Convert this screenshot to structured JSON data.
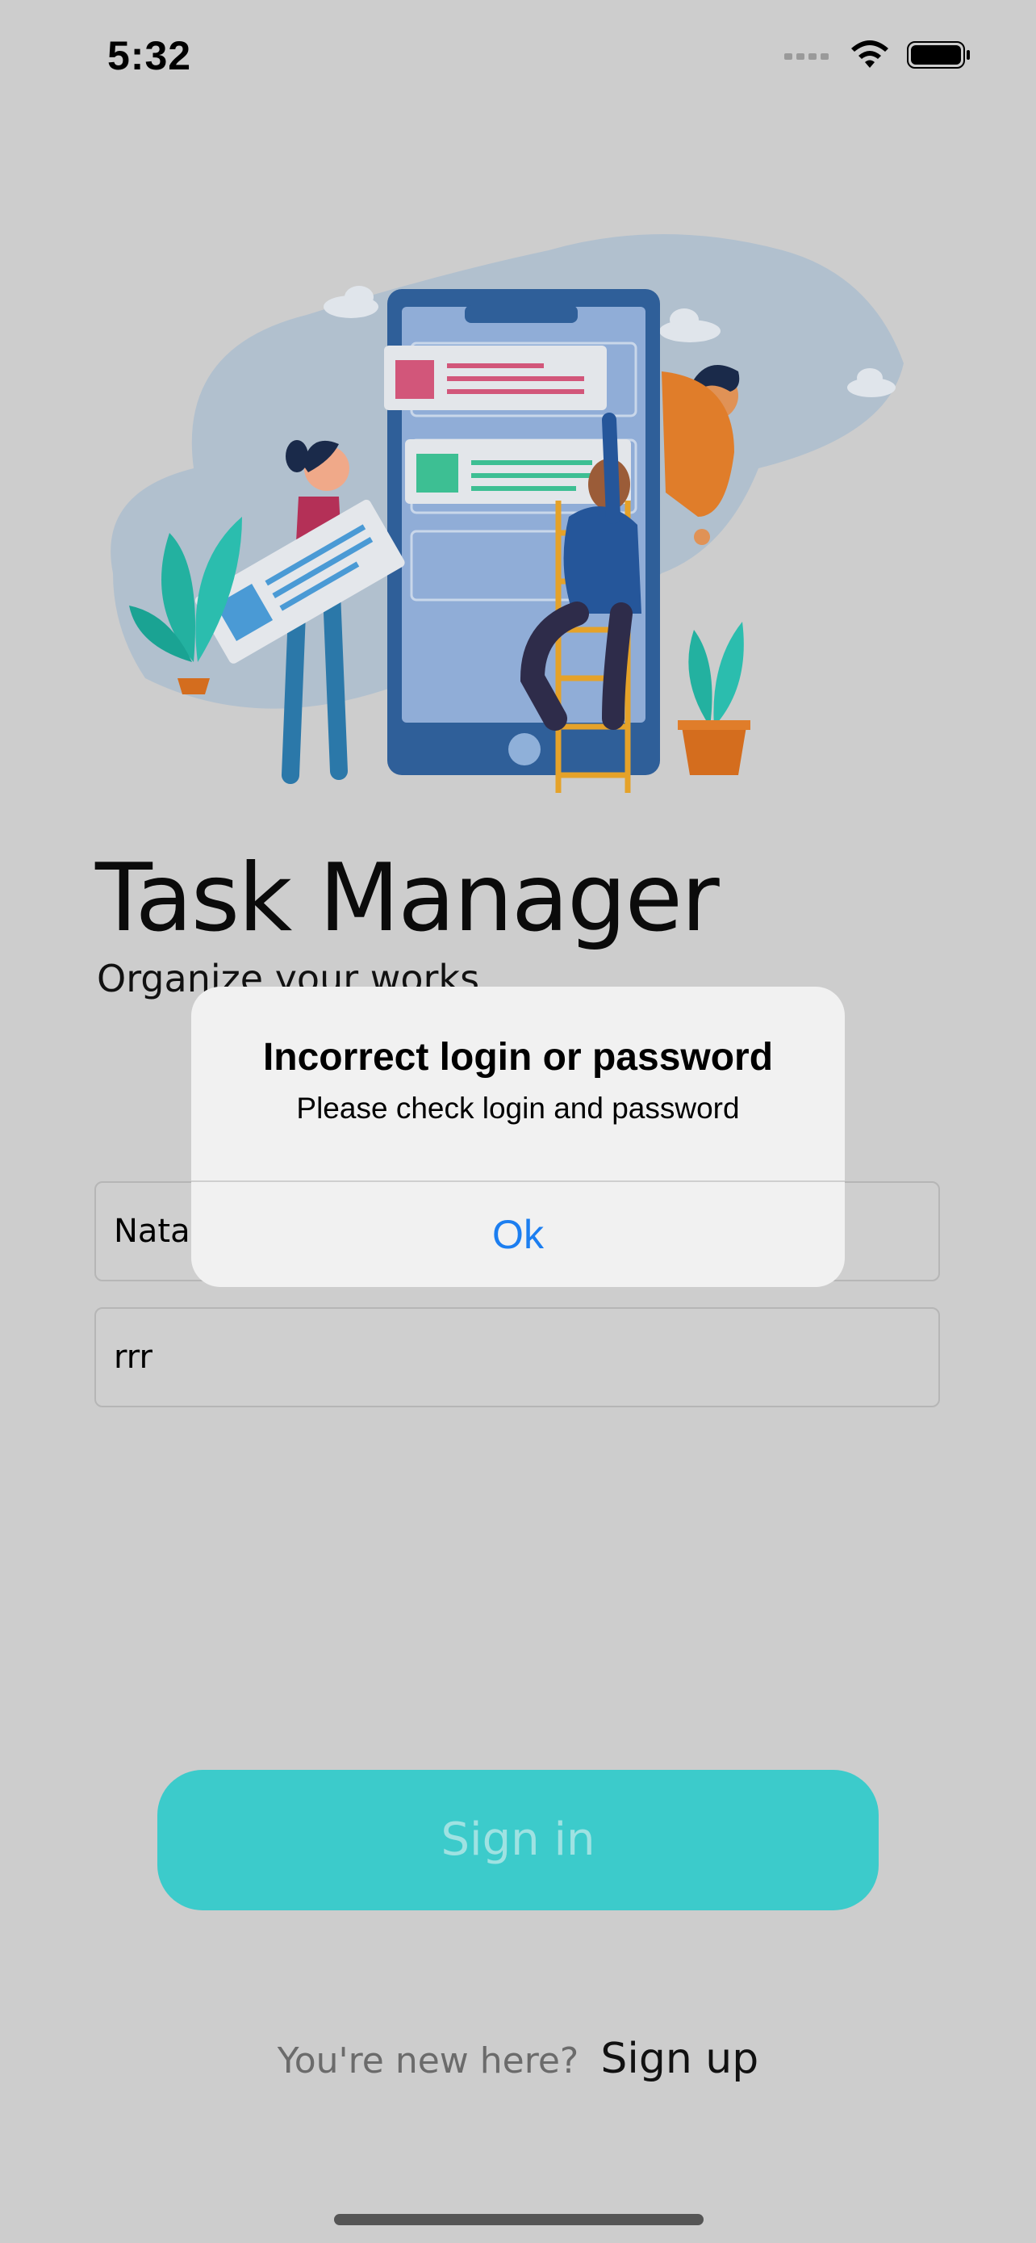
{
  "status_bar": {
    "time": "5:32",
    "icons": [
      "signal-icon",
      "wifi-icon",
      "battery-icon"
    ]
  },
  "app": {
    "title": "Task Manager",
    "subtitle": "Organize your works"
  },
  "form": {
    "login_value": "Natal",
    "password_value": "rrr",
    "signin_label": "Sign in",
    "signup_prompt": "You're new here?",
    "signup_label": "Sign up"
  },
  "alert": {
    "title": "Incorrect login or password",
    "message": "Please check login and password",
    "ok_label": "Ok"
  },
  "colors": {
    "background": "#cdcdcd",
    "accent": "#3ccbcb",
    "link_blue": "#1c7ef0"
  }
}
